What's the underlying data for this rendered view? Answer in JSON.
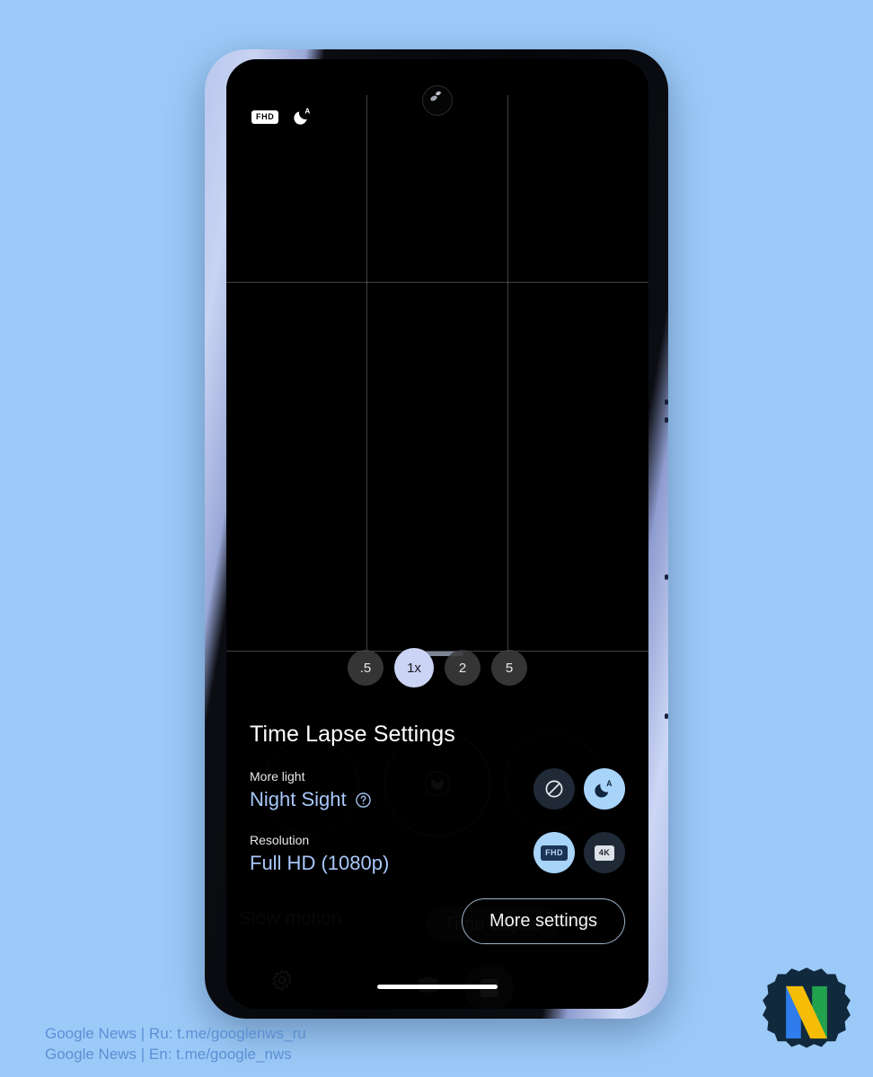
{
  "page": {
    "background_color": "#9ccaf8"
  },
  "phone": {
    "frame_color": "#b9c7ee",
    "screen_background": "#000000"
  },
  "viewfinder": {
    "grid": "rule-of-thirds",
    "grid_color": "#c8cdd7",
    "top_icons": [
      {
        "name": "fhd-badge",
        "label": "FHD"
      },
      {
        "name": "night-sight-auto-icon",
        "label": ""
      }
    ],
    "zoom_levels": [
      {
        "label": ".5",
        "selected": false
      },
      {
        "label": "1x",
        "selected": true
      },
      {
        "label": "2",
        "selected": false
      },
      {
        "label": "5",
        "selected": false
      }
    ]
  },
  "background_camera_ui": {
    "mode_left": "Slow motion",
    "mode_center": "Time Lapse"
  },
  "settings_sheet": {
    "title": "Time Lapse Settings",
    "rows": [
      {
        "label": "More light",
        "value": "Night Sight",
        "has_help": true,
        "options": [
          {
            "name": "off",
            "icon": "prohibition-icon",
            "label": "",
            "selected": false
          },
          {
            "name": "night-sight-auto",
            "icon": "moon-auto-icon",
            "label": "",
            "selected": true
          }
        ]
      },
      {
        "label": "Resolution",
        "value": "Full HD (1080p)",
        "has_help": false,
        "options": [
          {
            "name": "fhd",
            "icon": "fhd-badge-icon",
            "label": "FHD",
            "selected": true
          },
          {
            "name": "4k",
            "icon": "4k-badge-icon",
            "label": "4K",
            "selected": false
          }
        ]
      }
    ],
    "more_settings_label": "More settings",
    "accent_color": "#a8c7fa",
    "selected_chip_color": "#a8d4fa"
  },
  "watermark": {
    "line1": "Google News | Ru: t.me/googlenws_ru",
    "line2": "Google News | En: t.me/google_nws",
    "color": "#5b8fd4",
    "logo_letter": "N"
  }
}
